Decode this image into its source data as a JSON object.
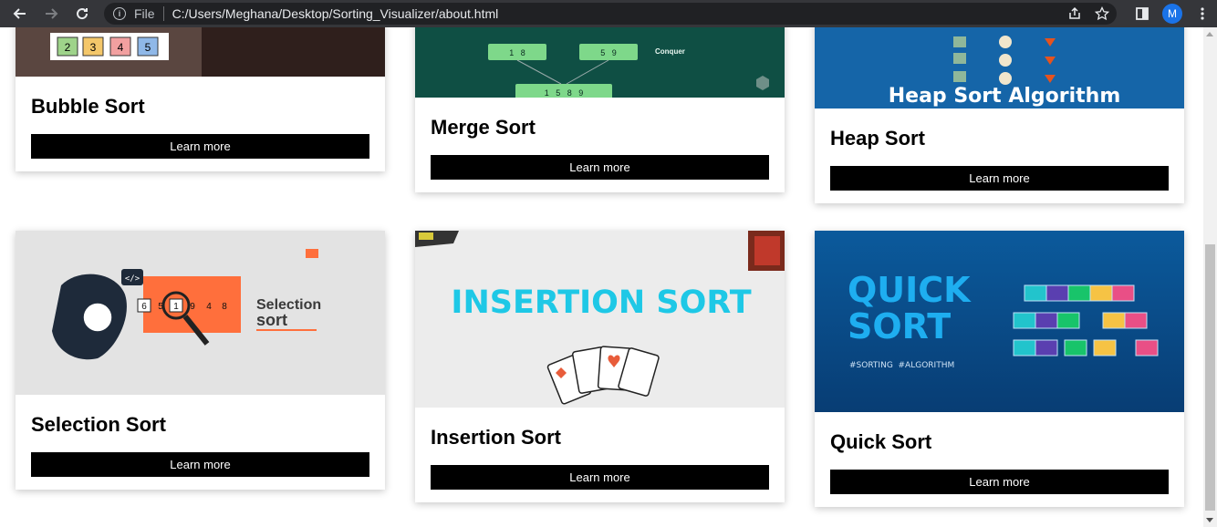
{
  "browser": {
    "scheme": "File",
    "url": "C:/Users/Meghana/Desktop/Sorting_Visualizer/about.html",
    "avatar_letter": "M"
  },
  "colors": {
    "chrome": "#35363a",
    "omnibox": "#202124",
    "button": "#000000",
    "heap_blue": "#1565a8",
    "merge_teal": "#0f4f44",
    "quick_blue": "#0b4f8f",
    "insertion_cyan": "#1ec8e6",
    "selection_orange": "#ff6f3c"
  },
  "cards": {
    "bubble": {
      "title": "Bubble Sort",
      "button": "Learn more",
      "numbers": [
        "2",
        "3",
        "4",
        "5"
      ]
    },
    "merge": {
      "title": "Merge Sort",
      "button": "Learn more",
      "boxes": [
        "1   8",
        "5   9",
        "1   5   8   9"
      ],
      "label": "Conquer"
    },
    "heap": {
      "title": "Heap Sort",
      "button": "Learn more",
      "image_title": "Heap Sort Algorithm"
    },
    "selection": {
      "title": "Selection Sort",
      "button": "Learn more",
      "image_word1": "Selection",
      "image_word2": "sort",
      "cells": [
        "6",
        "5",
        "1",
        "9",
        "4",
        "8"
      ],
      "code_tag": "</>"
    },
    "insertion": {
      "title": "Insertion Sort",
      "button": "Learn more",
      "image_title": "INSERTION SORT"
    },
    "quick": {
      "title": "Quick Sort",
      "button": "Learn more",
      "image_line1": "QUICK",
      "image_line2": "SORT",
      "hashtags": "#SORTING  #ALGORITHM"
    }
  }
}
